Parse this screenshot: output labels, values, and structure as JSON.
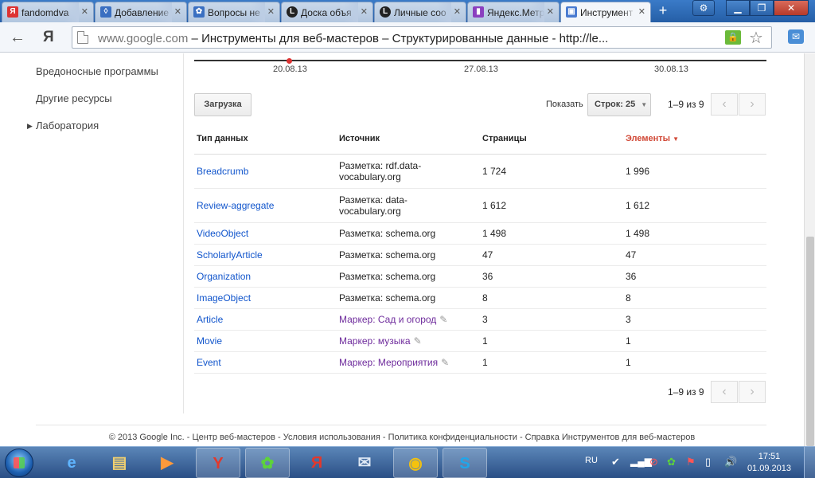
{
  "browser": {
    "tabs": [
      {
        "label": "fandomdva",
        "favicon": "Я",
        "favicon_color": "#d33"
      },
      {
        "label": "Добавление",
        "favicon": "◊",
        "favicon_color": "#3a6fc1"
      },
      {
        "label": "Вопросы не",
        "favicon": "✿",
        "favicon_color": "#3a6fc1"
      },
      {
        "label": "Доска объя",
        "favicon": "L",
        "favicon_color": "#222"
      },
      {
        "label": "Личные соо",
        "favicon": "L",
        "favicon_color": "#222"
      },
      {
        "label": "Яндекс.Метр",
        "favicon": "▮",
        "favicon_color": "#8b3fbf"
      },
      {
        "label": "Инструмент",
        "favicon": "▣",
        "favicon_color": "#4a7bd0"
      }
    ],
    "url_host": "www.google.com",
    "url_rest": " – Инструменты для веб-мастеров – Структурированные данные - http://le..."
  },
  "sidebar": {
    "items": [
      {
        "label": "Вредоносные программы"
      },
      {
        "label": "Другие ресурсы"
      },
      {
        "label": "Лаборатория"
      }
    ]
  },
  "chart": {
    "x_ticks": [
      "20.08.13",
      "27.08.13",
      "30.08.13"
    ]
  },
  "toolbar": {
    "upload_label": "Загрузка",
    "show_label": "Показать",
    "rows_label": "Строк: 25",
    "range_label": "1–9 из 9"
  },
  "table": {
    "headers": [
      "Тип данных",
      "Источник",
      "Страницы",
      "Элементы"
    ],
    "rows": [
      {
        "type": "Breadcrumb",
        "source": "Разметка: rdf.data-vocabulary.org",
        "pages": "1 724",
        "items": "1 996",
        "marker": false
      },
      {
        "type": "Review-aggregate",
        "source": "Разметка: data-vocabulary.org",
        "pages": "1 612",
        "items": "1 612",
        "marker": false
      },
      {
        "type": "VideoObject",
        "source": "Разметка: schema.org",
        "pages": "1 498",
        "items": "1 498",
        "marker": false
      },
      {
        "type": "ScholarlyArticle",
        "source": "Разметка: schema.org",
        "pages": "47",
        "items": "47",
        "marker": false
      },
      {
        "type": "Organization",
        "source": "Разметка: schema.org",
        "pages": "36",
        "items": "36",
        "marker": false
      },
      {
        "type": "ImageObject",
        "source": "Разметка: schema.org",
        "pages": "8",
        "items": "8",
        "marker": false
      },
      {
        "type": "Article",
        "source": "Маркер: Сад и огород",
        "pages": "3",
        "items": "3",
        "marker": true
      },
      {
        "type": "Movie",
        "source": "Маркер: музыка",
        "pages": "1",
        "items": "1",
        "marker": true
      },
      {
        "type": "Event",
        "source": "Маркер: Мероприятия",
        "pages": "1",
        "items": "1",
        "marker": true
      }
    ]
  },
  "footer": {
    "text": "© 2013 Google Inc. - Центр веб-мастеров - Условия использования - Политика конфиденциальности - Справка Инструментов для веб-мастеров"
  },
  "taskbar": {
    "lang": "RU",
    "time": "17:51",
    "date": "01.09.2013"
  },
  "colors": {
    "link": "#1155cc",
    "marker": "#6e2b9c",
    "sorted_header": "#d14836"
  }
}
